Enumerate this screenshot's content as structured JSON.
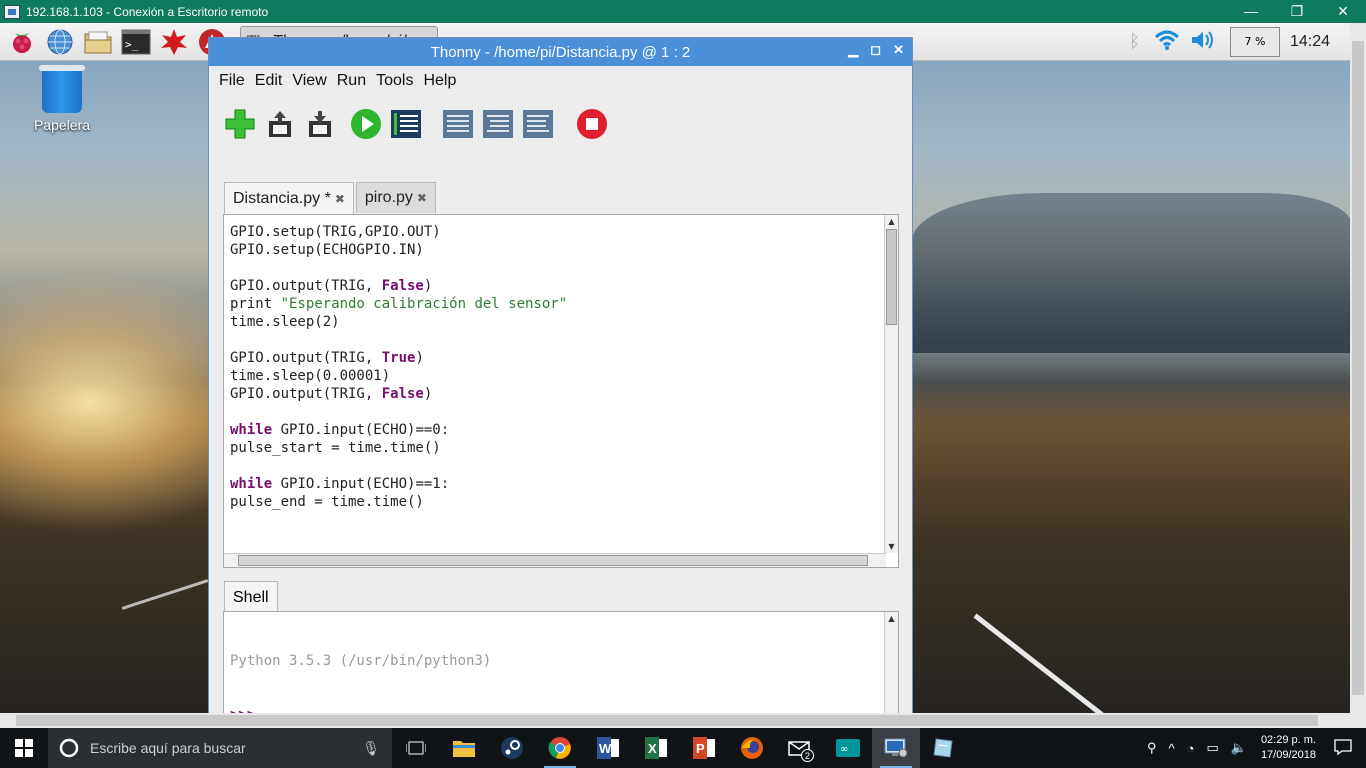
{
  "rdp_window": {
    "title": "192.168.1.103 - Conexión a Escritorio remoto",
    "minimize": "—",
    "maximize": "❐",
    "close": "✕"
  },
  "pi_panel": {
    "task_button": "Thonny  -  /home/pi/...",
    "cpu_usage": "7 %",
    "clock": "14:24"
  },
  "desktop": {
    "trash_label": "Papelera"
  },
  "thonny": {
    "title": "Thonny  -  /home/pi/Distancia.py  @  1 : 2",
    "menu": [
      "File",
      "Edit",
      "View",
      "Run",
      "Tools",
      "Help"
    ],
    "tabs": [
      {
        "label": "Distancia.py *"
      },
      {
        "label": "piro.py"
      }
    ],
    "code_lines": [
      "GPIO.setup(TRIG,GPIO.OUT)",
      "GPIO.setup(ECHOGPIO.IN)",
      "",
      "GPIO.output(TRIG, False)",
      "print \"Esperando calibración del sensor\"",
      "time.sleep(2)",
      "",
      "GPIO.output(TRIG, True)",
      "time.sleep(0.00001)",
      "GPIO.output(TRIG, False)",
      "",
      "while GPIO.input(ECHO)==0:",
      "pulse_start = time.time()",
      "",
      "while GPIO.input(ECHO)==1:",
      "pulse_end = time.time()"
    ],
    "shell_tab": "Shell",
    "shell_banner": "Python 3.5.3 (/usr/bin/python3)",
    "shell_prompt": ">>>"
  },
  "taskbar": {
    "search_placeholder": "Escribe aquí para buscar",
    "time": "02:29 p. m.",
    "date": "17/09/2018",
    "mail_badge": "2"
  }
}
